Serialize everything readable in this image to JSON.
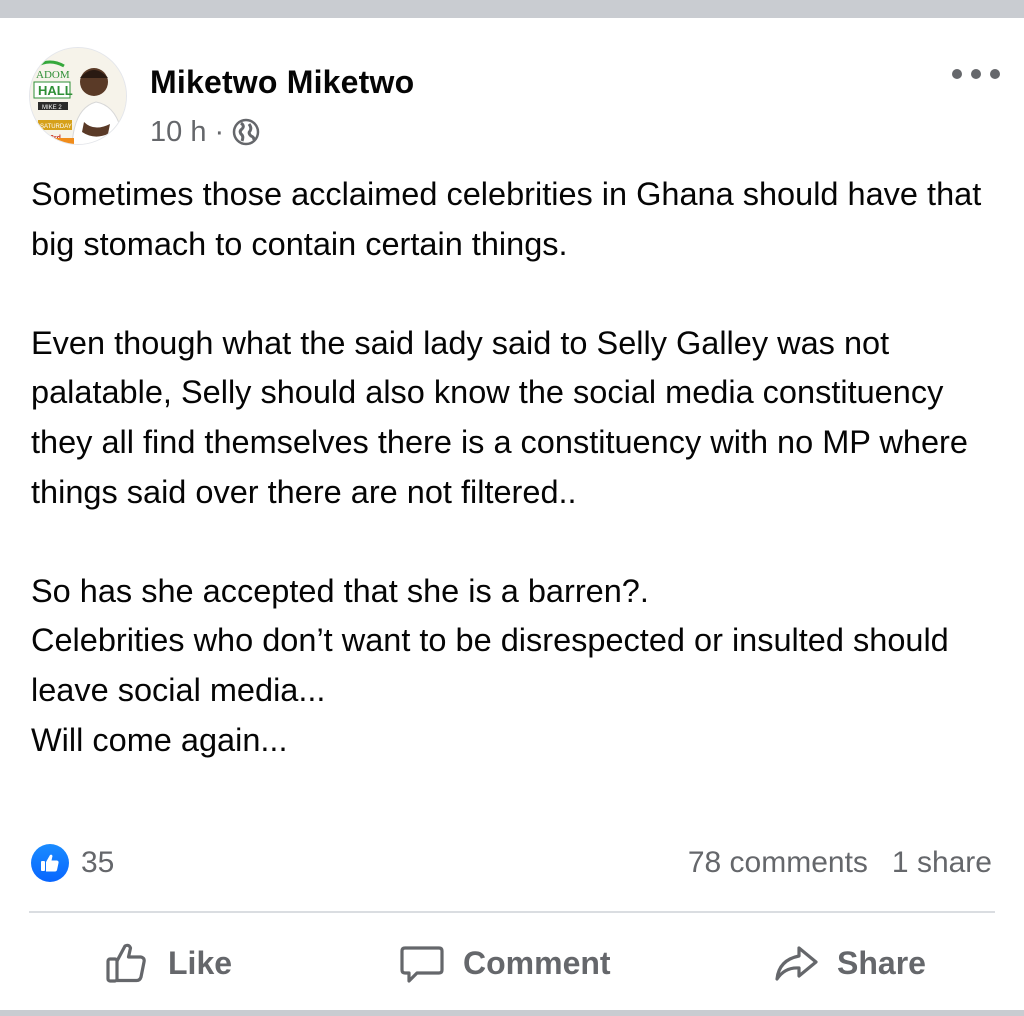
{
  "post": {
    "author": "Miketwo Miketwo",
    "time": "10 h",
    "separator": "·",
    "privacy_icon": "globe-icon",
    "avatar_text": {
      "top": "ADOM",
      "middle": "HALL",
      "badge": "MIKE 2",
      "event": "SATURDAY",
      "day": "3rd"
    },
    "paragraphs": [
      "Sometimes those acclaimed celebrities in Ghana should have that big stomach to contain certain things.",
      "Even though what the said lady said to Selly Galley was not palatable, Selly should also know the social media constituency they all find themselves there is a constituency with no MP where things said over there are not filtered..",
      "So has she accepted that she is a barren?.\nCelebrities who don’t want to be disrespected or insulted should leave social media...\nWill come again..."
    ],
    "reaction_count": "35",
    "comments": "78 comments",
    "shares": "1 share"
  },
  "actions": {
    "like": "Like",
    "comment": "Comment",
    "share": "Share"
  },
  "colors": {
    "accent": "#0866ff",
    "secondary_text": "#65676b",
    "primary_text": "#050505",
    "divider": "#dadde1"
  }
}
